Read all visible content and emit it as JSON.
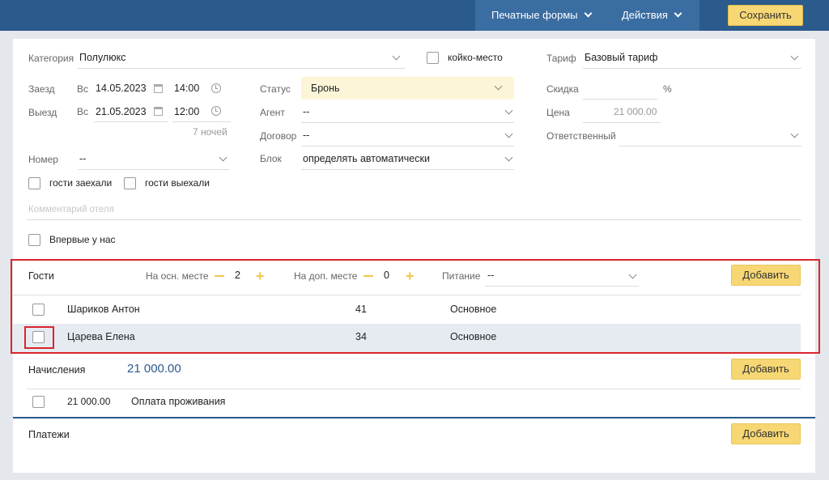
{
  "toolbar": {
    "print_forms": "Печатные формы",
    "actions": "Действия",
    "save": "Сохранить"
  },
  "booking": {
    "category_label": "Категория",
    "category_value": "Полулюкс",
    "bed_place_label": "койко-место",
    "tariff_label": "Тариф",
    "tariff_value": "Базовый тариф",
    "checkin_label": "Заезд",
    "checkin_day": "Вс",
    "checkin_date": "14.05.2023",
    "checkin_time": "14:00",
    "checkout_label": "Выезд",
    "checkout_day": "Вс",
    "checkout_date": "21.05.2023",
    "checkout_time": "12:00",
    "nights": "7 ночей",
    "status_label": "Статус",
    "status_value": "Бронь",
    "agent_label": "Агент",
    "agent_value": "--",
    "contract_label": "Договор",
    "contract_value": "--",
    "block_label": "Блок",
    "block_value": "определять автоматически",
    "discount_label": "Скидка",
    "discount_unit": "%",
    "price_label": "Цена",
    "price_value": "21 000.00",
    "responsible_label": "Ответственный",
    "room_label": "Номер",
    "room_value": "--",
    "guests_checked_in": "гости заехали",
    "guests_checked_out": "гости выехали",
    "comment_placeholder": "Комментарий отеля",
    "first_time": "Впервые у нас"
  },
  "guests": {
    "title": "Гости",
    "main_place_label": "На осн. месте",
    "main_place_count": "2",
    "extra_place_label": "На доп. месте",
    "extra_place_count": "0",
    "meal_label": "Питание",
    "meal_value": "--",
    "add": "Добавить",
    "rows": [
      {
        "name": "Шариков Антон",
        "age": "41",
        "meal": "Основное"
      },
      {
        "name": "Царева Елена",
        "age": "34",
        "meal": "Основное"
      }
    ]
  },
  "charges": {
    "title": "Начисления",
    "total": "21 000.00",
    "add": "Добавить",
    "rows": [
      {
        "amount": "21 000.00",
        "description": "Оплата проживания"
      }
    ]
  },
  "payments": {
    "title": "Платежи",
    "add": "Добавить"
  },
  "colors": {
    "topbar": "#2b5a8c",
    "accent_button": "#f7d774",
    "status_field": "#fcf5d8",
    "highlight": "#d9262c",
    "selected_row": "#e6ebf2",
    "total_amount": "#2b5a8c"
  }
}
